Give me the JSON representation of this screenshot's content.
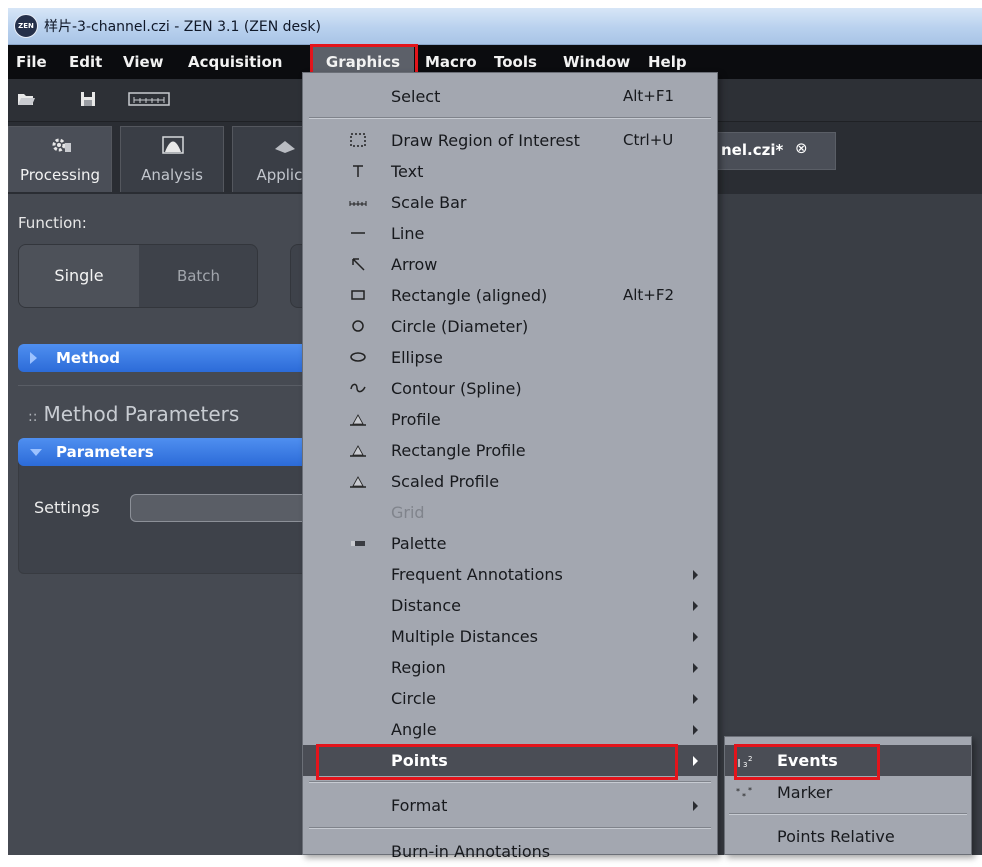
{
  "window": {
    "title": "样片-3-channel.czi - ZEN 3.1 (ZEN desk)",
    "logo_text": "ZEN"
  },
  "menubar": [
    "File",
    "Edit",
    "View",
    "Acquisition",
    "Graphics",
    "Macro",
    "Tools",
    "Window",
    "Help"
  ],
  "left_tabs": [
    "Processing",
    "Analysis",
    "Applica"
  ],
  "doc_tab": {
    "label": "nel.czi*",
    "close": "⊗"
  },
  "panel": {
    "function_label": "Function:",
    "single": "Single",
    "batch": "Batch",
    "method": "Method",
    "method_parameters": "Method Parameters",
    "parameters": "Parameters",
    "settings": "Settings"
  },
  "graphics_menu": {
    "items": [
      {
        "label": "Select",
        "shortcut": "Alt+F1"
      },
      {
        "label": "Draw Region of Interest",
        "shortcut": "Ctrl+U"
      },
      {
        "label": "Text"
      },
      {
        "label": "Scale Bar"
      },
      {
        "label": "Line"
      },
      {
        "label": "Arrow"
      },
      {
        "label": "Rectangle (aligned)",
        "shortcut": "Alt+F2"
      },
      {
        "label": "Circle (Diameter)"
      },
      {
        "label": "Ellipse"
      },
      {
        "label": "Contour (Spline)"
      },
      {
        "label": "Profile"
      },
      {
        "label": "Rectangle Profile"
      },
      {
        "label": "Scaled Profile"
      },
      {
        "label": "Grid"
      },
      {
        "label": "Palette"
      },
      {
        "label": "Frequent Annotations"
      },
      {
        "label": "Distance"
      },
      {
        "label": "Multiple Distances"
      },
      {
        "label": "Region"
      },
      {
        "label": "Circle"
      },
      {
        "label": "Angle"
      },
      {
        "label": "Points"
      },
      {
        "label": "Format"
      },
      {
        "label": "Burn-in Annotations"
      }
    ]
  },
  "points_submenu": {
    "items": [
      {
        "label": "Events"
      },
      {
        "label": "Marker"
      },
      {
        "label": "Points Relative"
      }
    ]
  },
  "colors": {
    "highlight": "#e3141b",
    "accent": "#2c6bd8"
  }
}
